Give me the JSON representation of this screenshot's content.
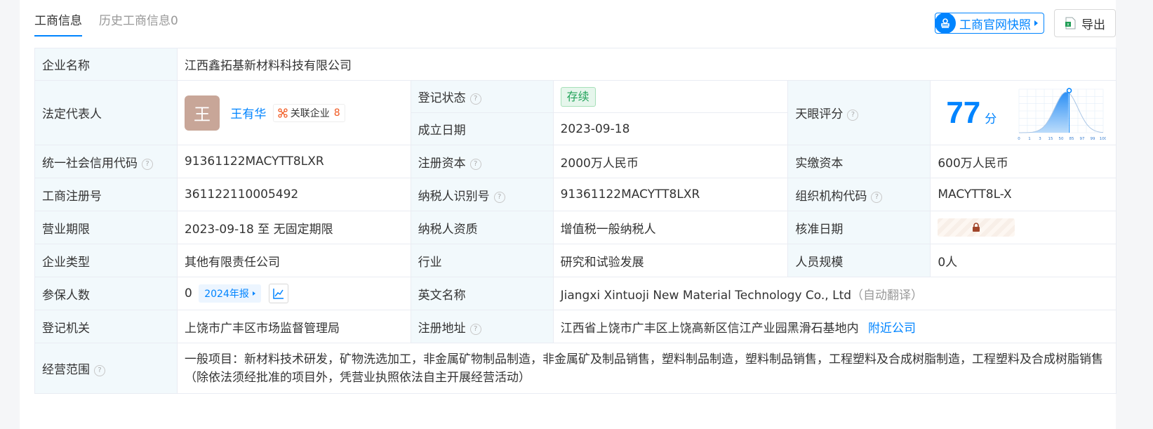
{
  "tabs": [
    {
      "label": "工商信息"
    },
    {
      "label": "历史工商信息0"
    }
  ],
  "actions": {
    "snapshot_label": "工商官网快照",
    "export_label": "导出"
  },
  "rows": {
    "company_name_label": "企业名称",
    "company_name_value": "江西鑫拓基新材料科技有限公司",
    "legal_rep_label": "法定代表人",
    "legal_rep_avatar": "王",
    "legal_rep_name": "王有华",
    "related_label": "关联企业",
    "related_count": "8",
    "reg_status_label": "登记状态",
    "reg_status_value": "存续",
    "est_date_label": "成立日期",
    "est_date_value": "2023-09-18",
    "tianyan_score_label": "天眼评分",
    "score_value": "77",
    "score_unit": "分",
    "credit_code_label": "统一社会信用代码",
    "credit_code_value": "91361122MACYTT8LXR",
    "reg_capital_label": "注册资本",
    "reg_capital_value": "2000万人民币",
    "paid_capital_label": "实缴资本",
    "paid_capital_value": "600万人民币",
    "reg_no_label": "工商注册号",
    "reg_no_value": "361122110005492",
    "taxpayer_id_label": "纳税人识别号",
    "taxpayer_id_value": "91361122MACYTT8LXR",
    "org_code_label": "组织机构代码",
    "org_code_value": "MACYTT8L-X",
    "term_label": "营业期限",
    "term_value": "2023-09-18 至 无固定期限",
    "taxpayer_qual_label": "纳税人资质",
    "taxpayer_qual_value": "增值税一般纳税人",
    "approval_date_label": "核准日期",
    "company_type_label": "企业类型",
    "company_type_value": "其他有限责任公司",
    "industry_label": "行业",
    "industry_value": "研究和试验发展",
    "staff_size_label": "人员规模",
    "staff_size_value": "0人",
    "insured_label": "参保人数",
    "insured_value": "0",
    "report_label": "2024年报",
    "english_name_label": "英文名称",
    "english_name_value": "Jiangxi Xintuoji New Material Technology Co., Ltd",
    "auto_translate": "（自动翻译）",
    "reg_authority_label": "登记机关",
    "reg_authority_value": "上饶市广丰区市场监督管理局",
    "reg_address_label": "注册地址",
    "reg_address_value": "江西省上饶市广丰区上饶高新区信江产业园黑滑石基地内",
    "nearby_label": "附近公司",
    "scope_label": "经营范围",
    "scope_value": "一般项目：新材料技术研发，矿物洗选加工，非金属矿物制品制造，非金属矿及制品销售，塑料制品制造，塑料制品销售，工程塑料及合成树脂制造，工程塑料及合成树脂销售（除依法须经批准的项目外，凭营业执照依法自主开展经营活动）"
  },
  "score_chart": {
    "x_ticks": [
      "0",
      "1",
      "3",
      "15",
      "50",
      "85",
      "97",
      "99",
      "100"
    ],
    "marker_value": 77
  },
  "colors": {
    "accent": "#0084ff",
    "label_bg": "#f2f9fc",
    "status_green": "#22a35a",
    "count_orange": "#f15a22"
  },
  "icons": {
    "snapshot": "stamp-icon",
    "export": "excel-icon",
    "help": "question-circle-icon",
    "related": "network-icon",
    "trend": "line-chart-icon",
    "lock": "lock-icon"
  }
}
